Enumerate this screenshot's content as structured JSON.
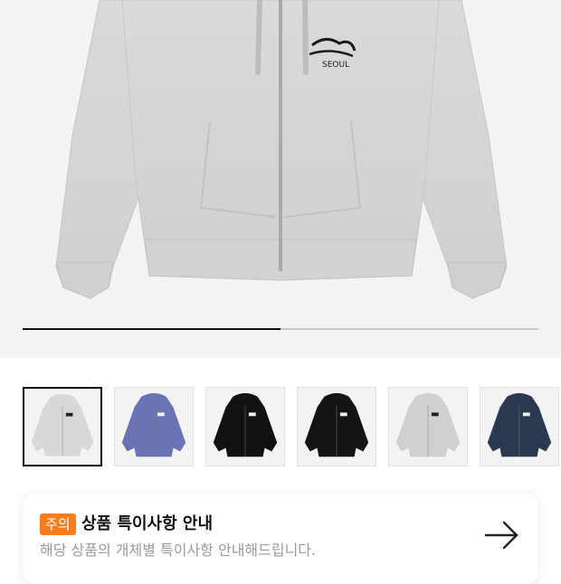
{
  "hero": {
    "product_image": "grey-zip-hoodie-front",
    "logo_text": "Stüssy",
    "logo_sub": "SEOUL",
    "carousel_progress": 0.5
  },
  "thumbnails": [
    {
      "color": "#d8d8d8",
      "label": "heather-grey",
      "selected": true
    },
    {
      "color": "#6a74b5",
      "label": "slate-blue",
      "selected": false
    },
    {
      "color": "#111111",
      "label": "black",
      "selected": false
    },
    {
      "color": "#141414",
      "label": "black-2",
      "selected": false
    },
    {
      "color": "#d0d0d2",
      "label": "grey",
      "selected": false
    },
    {
      "color": "#2a3850",
      "label": "navy",
      "selected": false
    }
  ],
  "notice": {
    "badge": "주의",
    "title": "상품 특이사항 안내",
    "subtitle": "해당 상품의 개체별 특이사항 안내해드립니다.",
    "arrow_icon": "arrow-right-icon"
  },
  "colors": {
    "accent": "#f47d20"
  }
}
